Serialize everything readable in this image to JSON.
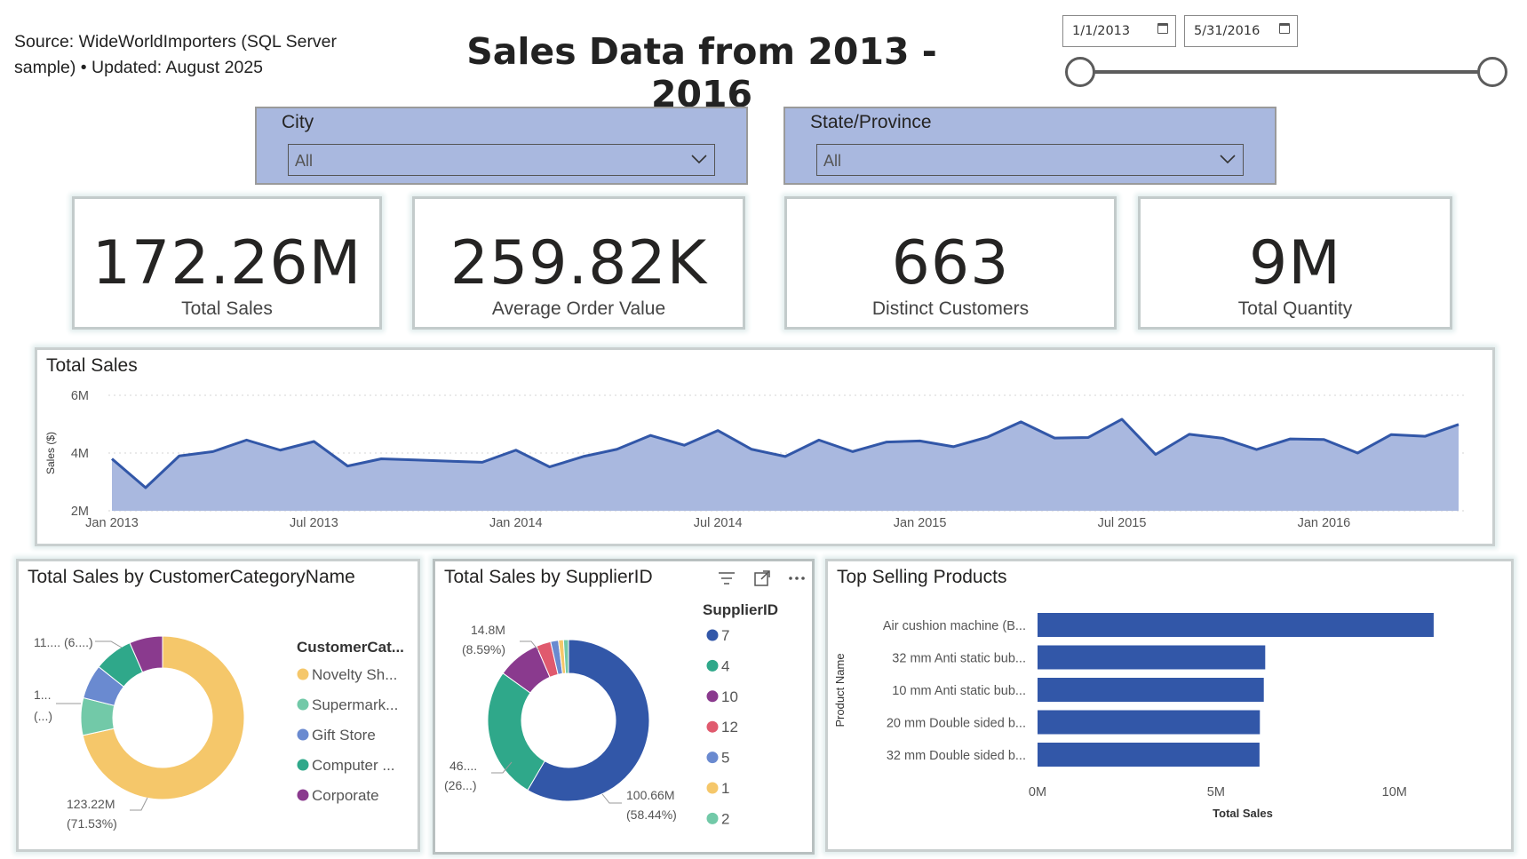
{
  "header": {
    "source_line1": "Source: WideWorldImporters (SQL Server",
    "source_line2": "sample) • Updated: August 2025",
    "title": "Sales Data from 2013 - 2016"
  },
  "date_range": {
    "start": "1/1/2013",
    "end": "5/31/2016",
    "slider_start_fraction": 0,
    "slider_end_fraction": 1
  },
  "slicers": {
    "city": {
      "label": "City",
      "value": "All"
    },
    "state": {
      "label": "State/Province",
      "value": "All"
    }
  },
  "cards": [
    {
      "value": "172.26M",
      "caption": "Total Sales"
    },
    {
      "value": "259.82K",
      "caption": "Average Order Value"
    },
    {
      "value": "663",
      "caption": "Distinct Customers"
    },
    {
      "value": "9M",
      "caption": "Total Quantity"
    }
  ],
  "colors": {
    "accent": "#3257a8",
    "area_fill": "#a9b8df",
    "slicer_bg": "#a9b8df",
    "yellow": "#f5c76a",
    "light_green": "#72c9a8",
    "blue_gray": "#6a8ad0",
    "teal": "#2fa88a",
    "purple": "#8a3a8e",
    "red": "#e05a6e"
  },
  "line_chart": {
    "title": "Total Sales",
    "ylabel": "Sales ($)",
    "y_ticks": [
      "6M",
      "4M",
      "2M"
    ],
    "x_ticks": [
      "Jan 2013",
      "Jul 2013",
      "Jan 2014",
      "Jul 2014",
      "Jan 2015",
      "Jul 2015",
      "Jan 2016"
    ]
  },
  "customer_pie": {
    "title": "Total Sales by CustomerCategoryName",
    "legend_title": "CustomerCat...",
    "legend": [
      {
        "name": "Novelty Sh...",
        "color": "#f5c76a"
      },
      {
        "name": "Supermark...",
        "color": "#72c9a8"
      },
      {
        "name": "Gift Store",
        "color": "#6a8ad0"
      },
      {
        "name": "Computer ...",
        "color": "#2fa88a"
      },
      {
        "name": "Corporate",
        "color": "#8a3a8e"
      }
    ],
    "labels": {
      "big_value": "123.22M",
      "big_pct": "(71.53%)",
      "mid_value": "1...",
      "mid_pct": "(...)",
      "top_value": "11.... (6....)"
    }
  },
  "supplier_pie": {
    "title": "Total Sales by SupplierID",
    "legend_title": "SupplierID",
    "legend": [
      {
        "name": "7",
        "color": "#3257a8"
      },
      {
        "name": "4",
        "color": "#2fa88a"
      },
      {
        "name": "10",
        "color": "#8a3a8e"
      },
      {
        "name": "12",
        "color": "#e05a6e"
      },
      {
        "name": "5",
        "color": "#6a8ad0"
      },
      {
        "name": "1",
        "color": "#f5c76a"
      },
      {
        "name": "2",
        "color": "#72c9a8"
      }
    ],
    "labels": {
      "big_value": "100.66M",
      "big_pct": "(58.44%)",
      "teal_value": "46....",
      "teal_pct": "(26...)",
      "top_value": "14.8M",
      "top_pct": "(8.59%)"
    },
    "icons": [
      "filter-icon",
      "focus-mode-icon",
      "more-options-icon"
    ]
  },
  "top_products": {
    "title": "Top Selling Products",
    "ylabel": "Product Name",
    "xlabel": "Total Sales",
    "x_ticks": [
      "0M",
      "5M",
      "10M"
    ]
  },
  "chart_data": [
    {
      "type": "area",
      "title": "Total Sales",
      "ylabel": "Sales ($)",
      "ylim": [
        2000000,
        6000000
      ],
      "x": [
        "2013-01",
        "2013-02",
        "2013-03",
        "2013-04",
        "2013-05",
        "2013-06",
        "2013-07",
        "2013-08",
        "2013-09",
        "2013-10",
        "2013-11",
        "2013-12",
        "2014-01",
        "2014-02",
        "2014-03",
        "2014-04",
        "2014-05",
        "2014-06",
        "2014-07",
        "2014-08",
        "2014-09",
        "2014-10",
        "2014-11",
        "2014-12",
        "2015-01",
        "2015-02",
        "2015-03",
        "2015-04",
        "2015-05",
        "2015-06",
        "2015-07",
        "2015-08",
        "2015-09",
        "2015-10",
        "2015-11",
        "2015-12",
        "2016-01",
        "2016-02",
        "2016-03",
        "2016-04",
        "2016-05"
      ],
      "values": [
        3800000,
        2800000,
        3900000,
        4050000,
        4450000,
        4100000,
        4400000,
        3550000,
        3800000,
        3760000,
        3720000,
        3680000,
        4100000,
        3520000,
        3880000,
        4130000,
        4610000,
        4270000,
        4780000,
        4130000,
        3880000,
        4450000,
        4050000,
        4380000,
        4420000,
        4220000,
        4550000,
        5080000,
        4520000,
        4540000,
        5170000,
        3950000,
        4650000,
        4510000,
        4120000,
        4490000,
        4470000,
        4000000,
        4640000,
        4580000,
        4990000
      ],
      "x_ticks": [
        "Jan 2013",
        "Jul 2013",
        "Jan 2014",
        "Jul 2014",
        "Jan 2015",
        "Jul 2015",
        "Jan 2016"
      ]
    },
    {
      "type": "pie",
      "title": "Total Sales by CustomerCategoryName",
      "categories": [
        "Novelty Sh...",
        "Supermark...",
        "Gift Store",
        "Computer ...",
        "Corporate"
      ],
      "values": [
        71.53,
        7.4,
        6.8,
        7.7,
        6.57
      ]
    },
    {
      "type": "pie",
      "title": "Total Sales by SupplierID",
      "categories": [
        "7",
        "4",
        "10",
        "12",
        "5",
        "1",
        "2"
      ],
      "values": [
        58.44,
        26.5,
        8.59,
        2.9,
        1.57,
        1.0,
        1.0
      ]
    },
    {
      "type": "bar",
      "orientation": "horizontal",
      "title": "Top Selling Products",
      "categories": [
        "Air cushion machine (B...",
        "32 mm Anti static bub...",
        "10 mm Anti static bub...",
        "20 mm Double sided b...",
        "32 mm Double sided b..."
      ],
      "values": [
        11100000,
        6380000,
        6340000,
        6230000,
        6220000
      ],
      "xlim": [
        0,
        11500000
      ],
      "x_ticks": [
        "0M",
        "5M",
        "10M"
      ],
      "xlabel": "Total Sales",
      "ylabel": "Product Name"
    }
  ]
}
